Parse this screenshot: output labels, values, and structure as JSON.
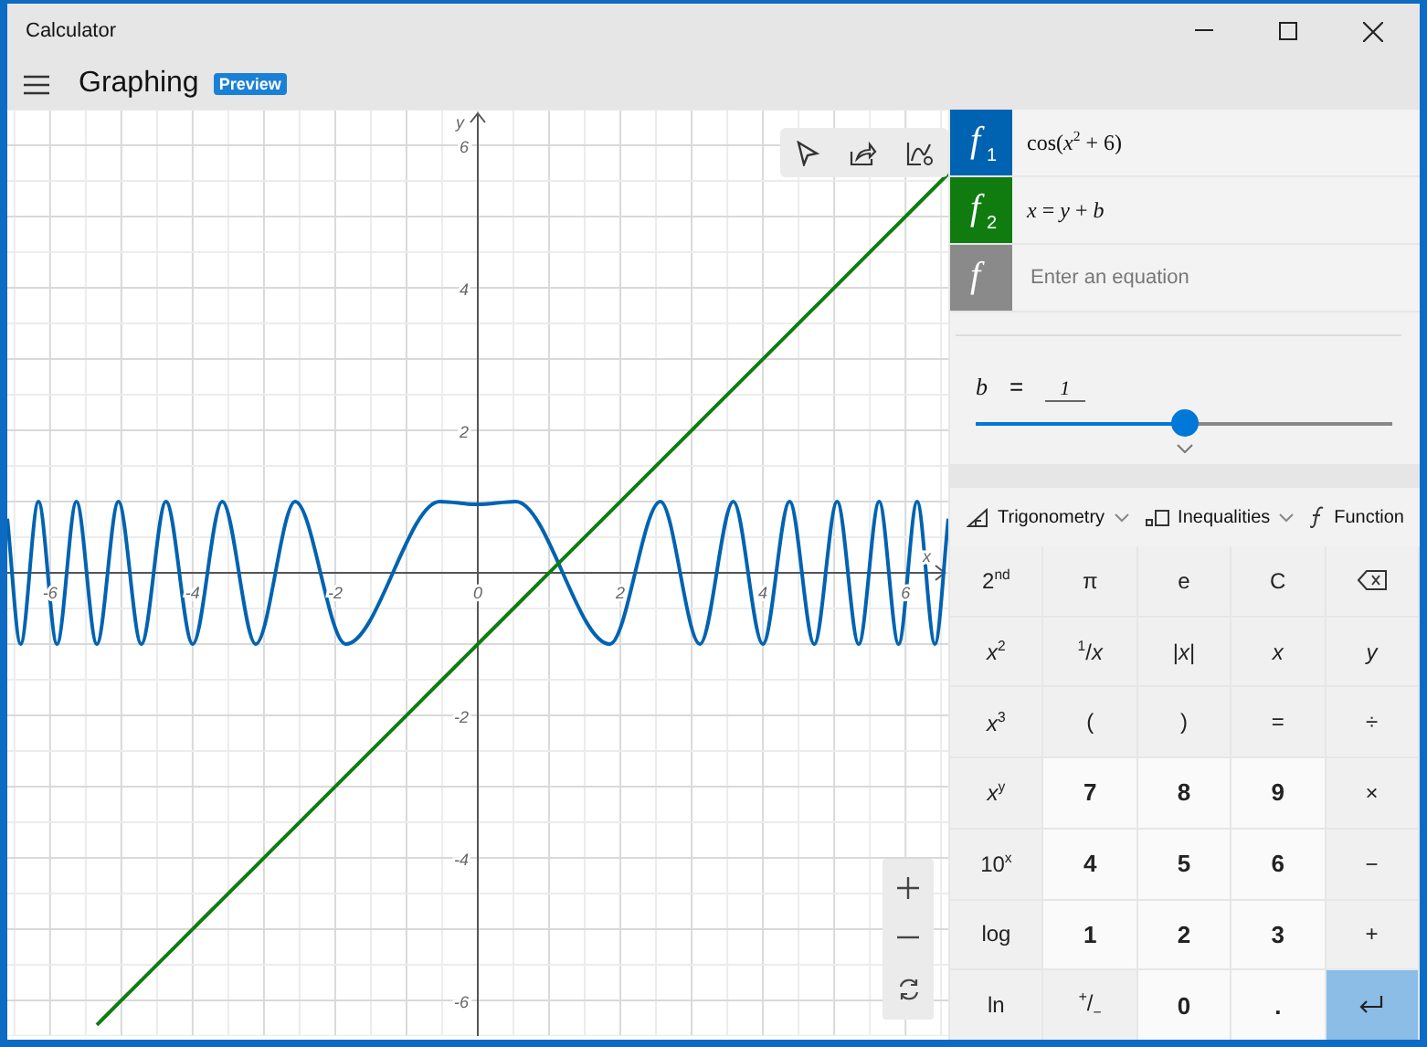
{
  "window": {
    "title": "Calculator"
  },
  "header": {
    "title": "Graphing",
    "badge": "Preview"
  },
  "graph": {
    "chart_data": {
      "type": "line",
      "grid": true,
      "xlabel": "x",
      "ylabel": "y",
      "xlim": [
        -6.6,
        6.6
      ],
      "ylim": [
        -6.5,
        6.5
      ],
      "xticks": [
        -6,
        -4,
        -2,
        0,
        2,
        4,
        6
      ],
      "yticks": [
        -6,
        -4,
        -2,
        2,
        4,
        6
      ],
      "x": [
        -6.6,
        -6.413,
        -6.163,
        -5.903,
        -5.63,
        -5.344,
        -5.041,
        -4.72,
        -4.374,
        -3.999,
        -3.585,
        -3.116,
        -2.562,
        -1.851,
        -0.532,
        0,
        0.532,
        1.851,
        2.562,
        3.116,
        3.585,
        3.999,
        4.374,
        4.72,
        5.041,
        5.344,
        5.63,
        5.903,
        6.163,
        6.413,
        6.6
      ],
      "series": [
        {
          "color": "#0063b1",
          "values": [
            0.761,
            -1,
            1,
            -1,
            1,
            -1,
            1,
            -1,
            1,
            -1,
            1,
            -1,
            1,
            -1,
            1,
            0.96,
            1,
            -1,
            1,
            -1,
            1,
            -1,
            1,
            -1,
            1,
            -1,
            1,
            -1,
            1,
            -1,
            0.761
          ]
        },
        {
          "color": "#107c10",
          "values": [
            null,
            null,
            null,
            null,
            null,
            -6.344,
            -6.041,
            -5.72,
            -5.374,
            -4.999,
            -4.585,
            -4.116,
            -3.562,
            -2.851,
            -1.532,
            -1,
            -0.468,
            0.851,
            1.562,
            2.116,
            2.585,
            2.999,
            3.374,
            3.72,
            4.041,
            4.344,
            4.63,
            4.903,
            5.163,
            5.413,
            5.6
          ]
        }
      ]
    }
  },
  "equations": [
    {
      "label": "f",
      "index": "1",
      "expression": "cos(*x*$^{2}$ + 6)",
      "color": "#0063b1"
    },
    {
      "label": "f",
      "index": "2",
      "expression": "*x* = *y* + *b*",
      "color": "#107c10"
    }
  ],
  "new_equation": {
    "label": "f",
    "placeholder": "Enter an equation"
  },
  "variable": {
    "name": "b",
    "sign": "=",
    "value": "1",
    "level": 0.5
  },
  "menus": [
    {
      "label": "Trigonometry",
      "kind": "trig"
    },
    {
      "label": "Inequalities",
      "kind": "ineq"
    },
    {
      "label": "Function",
      "kind": "func"
    }
  ],
  "keys": [
    {
      "label": "2$^{nd}$",
      "kind": "func"
    },
    {
      "label": "π",
      "kind": "func"
    },
    {
      "label": "e",
      "kind": "func"
    },
    {
      "label": "C",
      "kind": "func"
    },
    {
      "kind": "backspace"
    },
    {
      "label": "*x*$^{2}$",
      "kind": "func"
    },
    {
      "label": "$^{1}$/*x*",
      "kind": "func"
    },
    {
      "label": "|*x*|",
      "kind": "func"
    },
    {
      "label": "*x*",
      "kind": "func"
    },
    {
      "label": "*y*",
      "kind": "func"
    },
    {
      "label": "*x*$^{3}$",
      "kind": "func"
    },
    {
      "label": "(",
      "kind": "func"
    },
    {
      "label": ")",
      "kind": "func"
    },
    {
      "label": "=",
      "kind": "func"
    },
    {
      "label": "÷",
      "kind": "func"
    },
    {
      "label": "*x*$^{y}$",
      "kind": "func"
    },
    {
      "label": "7",
      "kind": "digit"
    },
    {
      "label": "8",
      "kind": "digit"
    },
    {
      "label": "9",
      "kind": "digit"
    },
    {
      "label": "×",
      "kind": "func"
    },
    {
      "label": "10$^{x}$",
      "kind": "func"
    },
    {
      "label": "4",
      "kind": "digit"
    },
    {
      "label": "5",
      "kind": "digit"
    },
    {
      "label": "6",
      "kind": "digit"
    },
    {
      "label": "−",
      "kind": "func"
    },
    {
      "label": "log",
      "kind": "func"
    },
    {
      "label": "1",
      "kind": "digit"
    },
    {
      "label": "2",
      "kind": "digit"
    },
    {
      "label": "3",
      "kind": "digit"
    },
    {
      "label": "+",
      "kind": "func"
    },
    {
      "label": "ln",
      "kind": "func"
    },
    {
      "label": "$^{+}$/$_{−}$",
      "kind": "func"
    },
    {
      "label": "0",
      "kind": "digit"
    },
    {
      "label": ".",
      "kind": "digit"
    },
    {
      "kind": "enter"
    }
  ]
}
